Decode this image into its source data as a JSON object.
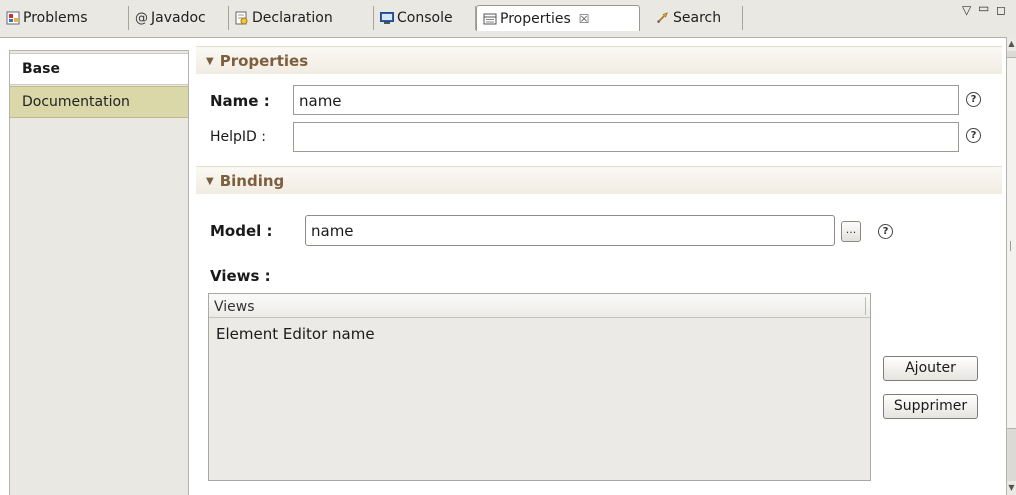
{
  "tabs": [
    {
      "label": "Problems",
      "icon": "problems-icon"
    },
    {
      "label": "Javadoc",
      "icon": "javadoc-icon"
    },
    {
      "label": "Declaration",
      "icon": "declaration-icon"
    },
    {
      "label": "Console",
      "icon": "console-icon"
    },
    {
      "label": "Properties",
      "icon": "properties-icon",
      "active": true
    },
    {
      "label": "Search",
      "icon": "search-icon"
    }
  ],
  "tab_close_glyph": "☒",
  "sidebar": {
    "items": [
      {
        "label": "Base",
        "selected": true
      },
      {
        "label": "Documentation",
        "selected": false
      }
    ]
  },
  "properties_section": {
    "title": "Properties",
    "name_label": "Name :",
    "name_value": "name",
    "helpid_label": "HelpID :",
    "helpid_value": ""
  },
  "binding_section": {
    "title": "Binding",
    "model_label": "Model :",
    "model_value": "name",
    "browse_label": "...",
    "views_label": "Views :"
  },
  "views_table": {
    "header": "Views",
    "rows": [
      "Element Editor name"
    ]
  },
  "buttons": {
    "add": "Ajouter",
    "remove": "Supprimer"
  },
  "help_glyph": "?",
  "colors": {
    "section_title": "#7d5f3f",
    "doc_tab_bg": "#dad7a8",
    "tabbar_bg": "#eae8e3"
  }
}
